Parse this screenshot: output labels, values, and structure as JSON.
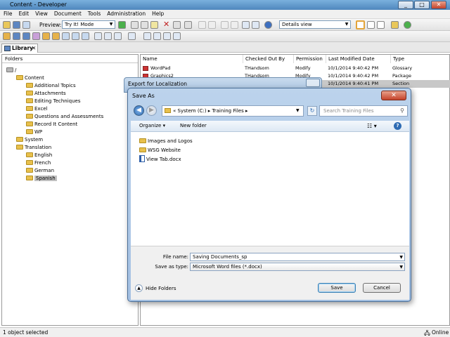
{
  "window": {
    "title": "Content - Developer",
    "min": "_",
    "max": "□",
    "close": "✕"
  },
  "menu": [
    "File",
    "Edit",
    "View",
    "Document",
    "Tools",
    "Administration",
    "Help"
  ],
  "toolbar": {
    "preview_label": "Preview:",
    "preview_mode": "Try It! Mode",
    "view_mode": "Details view"
  },
  "library_tab": {
    "label": "Library",
    "close": "✕"
  },
  "folders_header": "Folders",
  "tree": [
    {
      "label": "/",
      "depth": 0
    },
    {
      "label": "Content",
      "depth": 1
    },
    {
      "label": "Additional Topics",
      "depth": 2
    },
    {
      "label": "Attachments",
      "depth": 2
    },
    {
      "label": "Editing Techniques",
      "depth": 2
    },
    {
      "label": "Excel",
      "depth": 2
    },
    {
      "label": "Questions and Assessments",
      "depth": 2
    },
    {
      "label": "Record It Content",
      "depth": 2
    },
    {
      "label": "WP",
      "depth": 2
    },
    {
      "label": "System",
      "depth": 1
    },
    {
      "label": "Translation",
      "depth": 1
    },
    {
      "label": "English",
      "depth": 2
    },
    {
      "label": "French",
      "depth": 2
    },
    {
      "label": "German",
      "depth": 2
    },
    {
      "label": "Spanish",
      "depth": 2
    }
  ],
  "columns": [
    "Name",
    "Checked Out By",
    "Permission",
    "Last Modified Date",
    "Type"
  ],
  "rows": [
    {
      "name": "WordPad",
      "by": "THandsom",
      "perm": "Modify",
      "date": "10/1/2014 9:40:42 PM",
      "type": "Glossary"
    },
    {
      "name": "Graphics2",
      "by": "THandsom",
      "perm": "Modify",
      "date": "10/1/2014 9:40:42 PM",
      "type": "Package"
    },
    {
      "name": "",
      "by": "",
      "perm": "",
      "date": "10/1/2014 9:40:41 PM",
      "type": "Section"
    }
  ],
  "export_dialog": {
    "title": "Export for Localization"
  },
  "saveas": {
    "title": "Save As",
    "close": "✕",
    "address": "« System (C:) ▸ Training Files ▸",
    "search_placeholder": "Search Training Files",
    "organize": "Organize ▾",
    "new_folder": "New folder",
    "help": "?",
    "files": [
      {
        "name": "Images and Logos",
        "kind": "folder"
      },
      {
        "name": "WSG Website",
        "kind": "folder"
      },
      {
        "name": "View Tab.docx",
        "kind": "doc"
      }
    ],
    "file_name_label": "File name:",
    "file_name_value": "Saving Documents_sp",
    "save_type_label": "Save as type:",
    "save_type_value": "Microsoft Word files (*.docx)",
    "hide_folders": "Hide Folders",
    "save": "Save",
    "cancel": "Cancel"
  },
  "status": {
    "left": "1 object selected",
    "right": "Online"
  }
}
